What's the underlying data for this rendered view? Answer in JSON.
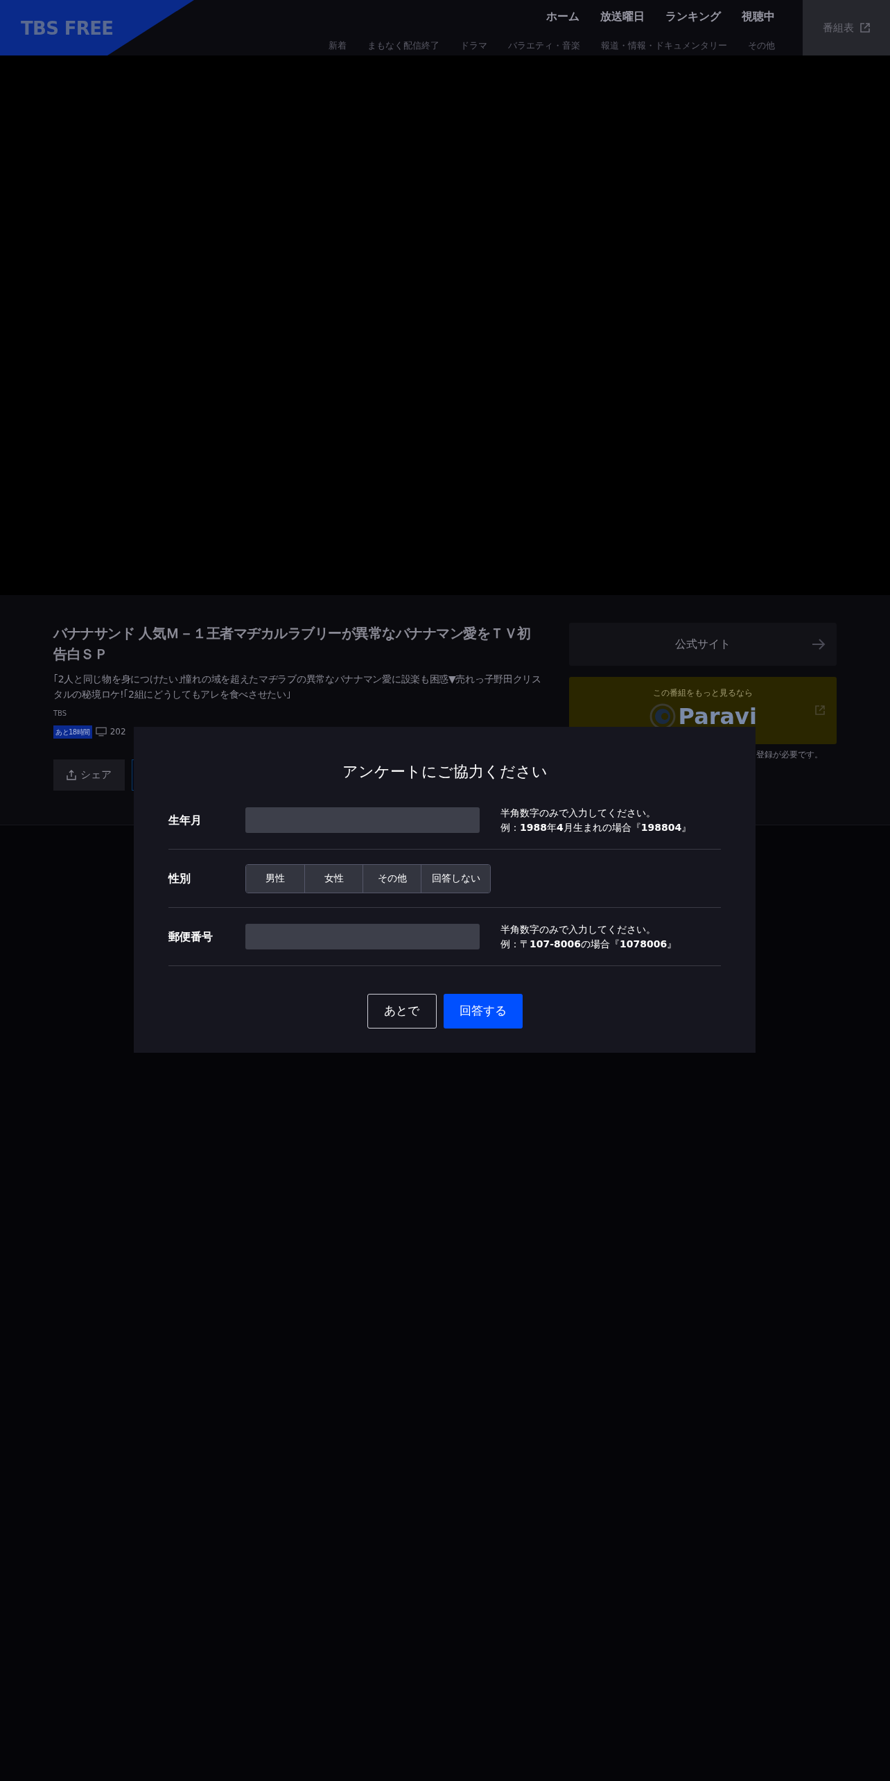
{
  "header": {
    "logo": "TBS FREE",
    "main_nav": [
      "ホーム",
      "放送曜日",
      "ランキング",
      "視聴中"
    ],
    "sub_nav": [
      "新着",
      "まもなく配信終了",
      "ドラマ",
      "バラエティ・音楽",
      "報道・情報・ドキュメンタリー",
      "その他"
    ],
    "schedule_button": "番組表"
  },
  "program": {
    "title": "バナナサンド 人気Ｍ－１王者マヂカルラブリーが異常なバナナマン愛をＴＶ初告白ＳＰ",
    "description": "｢2人と同じ物を身につけたい｣憧れの域を超えたマヂラブの異常なバナナマン愛に設楽も困惑▼売れっ子野田クリスタルの秘境ロケ!｢2組にどうしてもアレを食べさせたい｣",
    "broadcaster": "TBS",
    "remaining": "あと18時間",
    "date": "202",
    "share_button": "シェア"
  },
  "side": {
    "official_site": "公式サイト",
    "paravi_caption": "この番組をもっと見るなら",
    "paravi_logo": "Paravi",
    "note": "登録が必要です。"
  },
  "survey": {
    "title": "アンケートにご協力ください",
    "rows": [
      {
        "kind": "text",
        "label": "生年月",
        "hint": "半角数字のみで入力してください。",
        "example": "例：**1988**年**4**月生まれの場合『**198804**』"
      },
      {
        "kind": "choice",
        "label": "性別",
        "options": [
          "男性",
          "女性",
          "その他",
          "回答しない"
        ]
      },
      {
        "kind": "text",
        "label": "郵便番号",
        "hint": "半角数字のみで入力してください。",
        "example": "例：〒**107-8006**の場合『**1078006**』"
      }
    ],
    "later_button": "あとで",
    "submit_button": "回答する"
  }
}
